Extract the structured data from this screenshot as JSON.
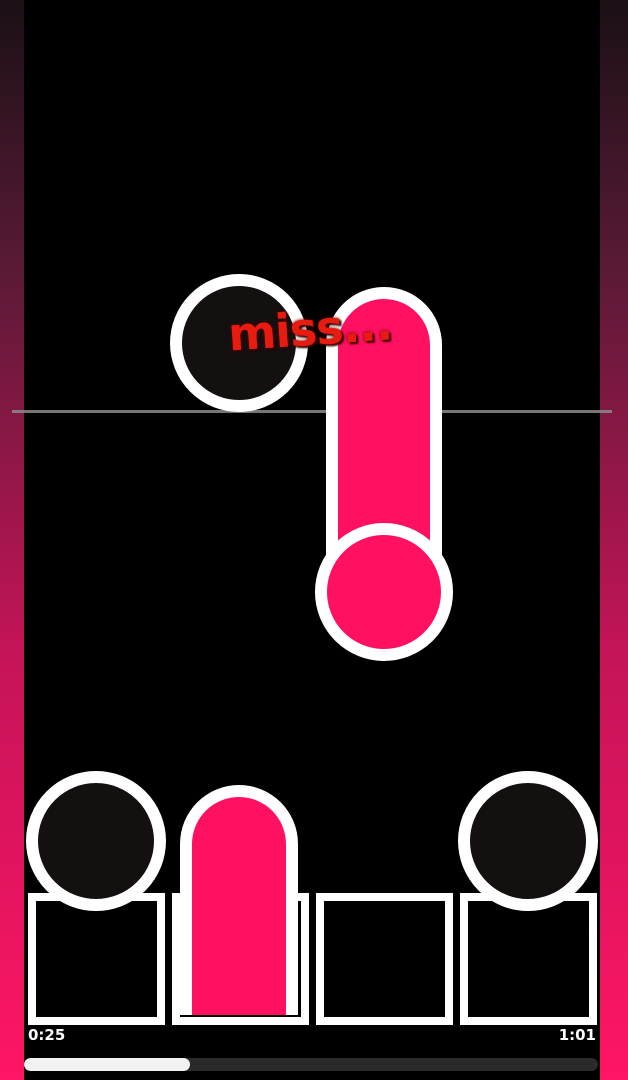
{
  "judgement": "miss...",
  "time": {
    "elapsed": "0:25",
    "total": "1:01"
  },
  "progress": 0.29,
  "colors": {
    "accent": "#ff1060",
    "note_dark": "#141010",
    "outline": "#ffffff",
    "miss": "#e81b10"
  },
  "lanes": [
    "lane-1",
    "lane-2",
    "lane-3",
    "lane-4"
  ]
}
